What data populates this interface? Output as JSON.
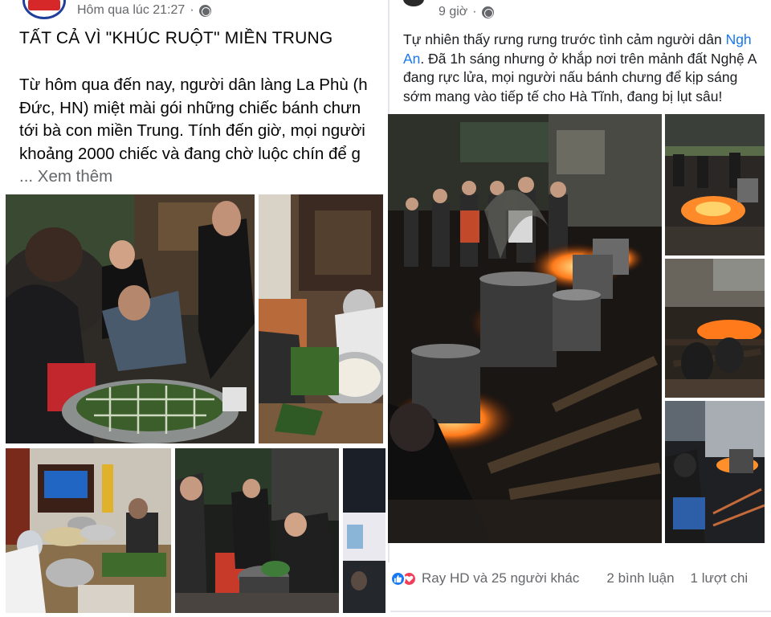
{
  "left_post": {
    "timestamp": "Hôm qua lúc 21:27",
    "separator": "·",
    "privacy_icon": "globe-icon",
    "title": "TẤT CẢ VÌ \"KHÚC RUỘT\" MIỀN TRUNG",
    "body_lines": [
      "Từ hôm qua đến nay, người dân làng La Phù (h",
      "Đức, HN) miệt mài gói những chiếc bánh chưn",
      "tới bà con miền Trung. Tính đến giờ, mọi người",
      "khoảng 2000 chiếc và đang chờ luộc chín để g"
    ],
    "see_more": "... Xem thêm",
    "avatar_icon": "page-avatar-icon"
  },
  "right_post": {
    "timestamp": "9 giờ",
    "separator": "·",
    "privacy_icon": "globe-icon",
    "body_lines": [
      {
        "pre": "Tự nhiên thấy rưng rưng trước tình cảm người dân ",
        "link": "Ngh"
      },
      {
        "pre": "",
        "link": "An",
        "post": ". Đã 1h sáng nhưng ở khắp nơi trên mảnh đất Nghệ A"
      },
      {
        "pre": "đang rực lửa, mọi người nấu bánh chưng để kịp sáng",
        "link": ""
      },
      {
        "pre": "sớm mang vào tiếp tế cho Hà Tĩnh, đang bị lụt sâu!",
        "link": ""
      }
    ],
    "reactions": {
      "icons": [
        "like-icon",
        "love-icon"
      ],
      "summary": "Ray HD và 25 người khác",
      "comments": "2 bình luận",
      "shares": "1 lượt chi"
    }
  },
  "colors": {
    "link": "#1877f2",
    "meta_text": "#65676b",
    "like": "#1877f2",
    "love": "#f33e58"
  }
}
